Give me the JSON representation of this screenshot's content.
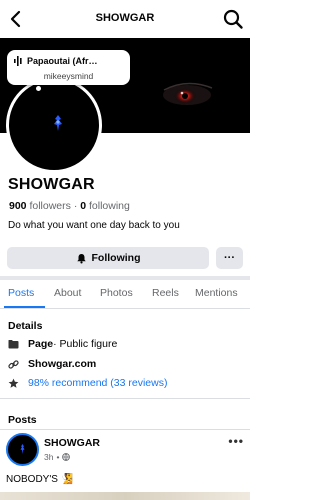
{
  "header": {
    "title": "SHOWGAR",
    "back_icon": "back-arrow-icon",
    "search_icon": "search-icon"
  },
  "note": {
    "song": "Papaoutai (Afr…",
    "user": "mikeeysmind"
  },
  "profile": {
    "name": "SHOWGAR",
    "followers_count": "900",
    "followers_label": "followers",
    "dot": "·",
    "following_count": "0",
    "following_label": "following",
    "bio": "Do what you want one day back to you"
  },
  "actions": {
    "following_label": "Following",
    "more_label": "···"
  },
  "tabs": [
    "Posts",
    "About",
    "Photos",
    "Reels",
    "Mentions"
  ],
  "details": {
    "title": "Details",
    "category_prefix": "Page",
    "category_rest": " · Public figure",
    "website": "Showgar.com",
    "recommend": "98% recommend (33 reviews)"
  },
  "posts": {
    "title": "Posts",
    "author": "SHOWGAR",
    "time": "3h",
    "dot": "•",
    "text": "NOBODY'S 🧏",
    "more_label": "•••"
  },
  "colors": {
    "accent": "#1877f2",
    "button_bg": "#e4e6eb",
    "muted": "#65676b",
    "cover": "#000000"
  }
}
